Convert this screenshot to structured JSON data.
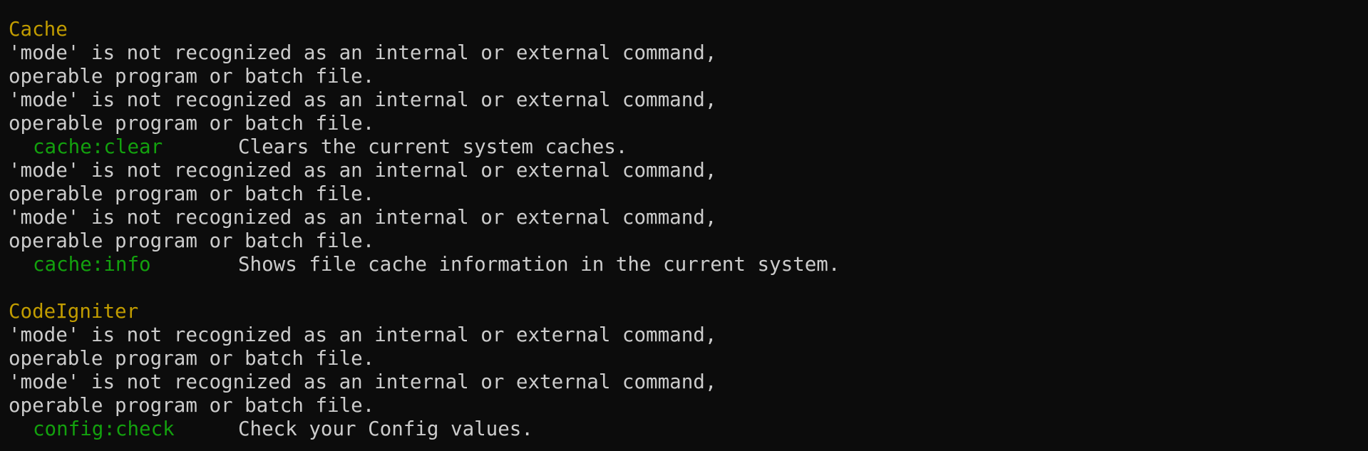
{
  "terminal": {
    "colors": {
      "background": "#0c0c0c",
      "text": "#cccccc",
      "heading": "#c19c00",
      "command": "#13a10e"
    },
    "lines": [
      {
        "type": "heading",
        "text": "Cache"
      },
      {
        "type": "text",
        "text": "'mode' is not recognized as an internal or external command,"
      },
      {
        "type": "text",
        "text": "operable program or batch file."
      },
      {
        "type": "text",
        "text": "'mode' is not recognized as an internal or external command,"
      },
      {
        "type": "text",
        "text": "operable program or batch file."
      },
      {
        "type": "command",
        "command": "cache:clear",
        "description": "Clears the current system caches."
      },
      {
        "type": "text",
        "text": "'mode' is not recognized as an internal or external command,"
      },
      {
        "type": "text",
        "text": "operable program or batch file."
      },
      {
        "type": "text",
        "text": "'mode' is not recognized as an internal or external command,"
      },
      {
        "type": "text",
        "text": "operable program or batch file."
      },
      {
        "type": "command",
        "command": "cache:info",
        "description": "Shows file cache information in the current system."
      },
      {
        "type": "blank",
        "text": ""
      },
      {
        "type": "heading",
        "text": "CodeIgniter"
      },
      {
        "type": "text",
        "text": "'mode' is not recognized as an internal or external command,"
      },
      {
        "type": "text",
        "text": "operable program or batch file."
      },
      {
        "type": "text",
        "text": "'mode' is not recognized as an internal or external command,"
      },
      {
        "type": "text",
        "text": "operable program or batch file."
      },
      {
        "type": "command",
        "command": "config:check",
        "description": "Check your Config values."
      }
    ]
  }
}
